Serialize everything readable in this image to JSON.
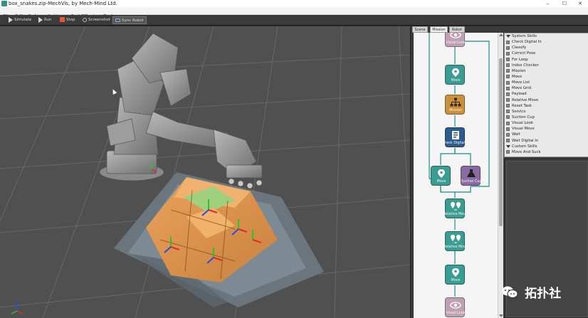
{
  "window": {
    "title": "box_snakes.zip-MechVis, by Mech-Mind Ltd.",
    "controls": [
      "–",
      "☐",
      "✕"
    ]
  },
  "menu": [
    "File",
    "Edit",
    "Debug",
    "Settings",
    "End Effector",
    "Tools"
  ],
  "toolbar": {
    "simulate": "Simulate",
    "run": "Run",
    "stop": "Stop",
    "screenshot": "Screenshot",
    "sync_robot": "Sync Robot"
  },
  "tabs": [
    "Scene",
    "Mission",
    "Robot"
  ],
  "flow_nodes": [
    {
      "label": "Visual Look",
      "color": "#c0a1b4",
      "icon": "eye-icon"
    },
    {
      "label": "Move",
      "color": "#3b9c93",
      "icon": "location-pin-icon"
    },
    {
      "label": "Mission",
      "color": "#c8913a",
      "icon": "hierarchy-icon"
    },
    {
      "label": "Check Digital In",
      "color": "#2e5b8e",
      "icon": "check-digital-icon"
    },
    {
      "label": "Move",
      "color": "#3b9c93",
      "icon": "location-pin-icon"
    },
    {
      "label": "Suction Cup",
      "color": "#8a6aa3",
      "icon": "suction-cup-icon"
    },
    {
      "label": "Relative Move",
      "color": "#3b9c93",
      "icon": "relative-move-icon"
    },
    {
      "label": "Relative Move",
      "color": "#3b9c93",
      "icon": "relative-move-icon"
    },
    {
      "label": "Move",
      "color": "#3b9c93",
      "icon": "location-pin-icon"
    },
    {
      "label": "Visual Look",
      "color": "#c0a1b4",
      "icon": "eye-icon"
    }
  ],
  "skills": {
    "header": "System Skills",
    "items": [
      "Check Digital In",
      "Classify",
      "Correct Pose",
      "For Loop",
      "Index Checker",
      "Mission",
      "Move",
      "Move List",
      "Move Grid",
      "Payload",
      "Relative Move",
      "Reset Task",
      "Service",
      "Suction Cup",
      "Visual Look",
      "Visual Move",
      "Wait",
      "Wait Digital In"
    ],
    "custom_header": "Custom Skills",
    "custom_items": [
      "Move And Suck"
    ]
  },
  "watermark": "拓扑社",
  "colors": {
    "flow_wire": "#1f8a86",
    "viewport_bg": "#505050"
  }
}
